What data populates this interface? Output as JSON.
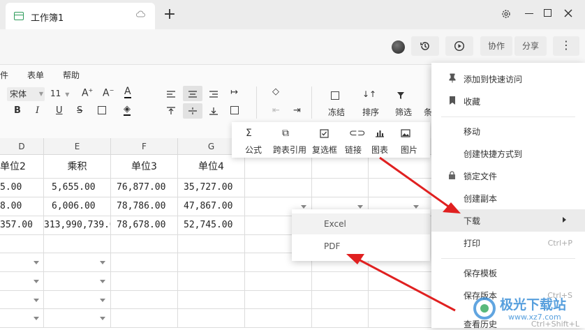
{
  "tab": {
    "title": "工作簿1"
  },
  "header": {
    "collab_label": "协作",
    "share_label": "分享"
  },
  "menubar": {
    "items": [
      "件",
      "表单",
      "帮助"
    ]
  },
  "toolbar": {
    "font_name": "宋体",
    "font_size": "11",
    "bold": "B",
    "italic": "I",
    "underline": "U",
    "strike": "S",
    "freeze_label": "冻结",
    "sort_label": "排序",
    "filter_label": "筛选",
    "cond_label": "条"
  },
  "insert_panel": {
    "items": [
      "公式",
      "跨表引用",
      "复选框",
      "链接",
      "图表",
      "图片"
    ]
  },
  "grid": {
    "columns": [
      "D",
      "E",
      "F",
      "G"
    ],
    "header_row": [
      "单位2",
      "乘积",
      "单位3",
      "单位4"
    ],
    "rows": [
      [
        "5.00",
        "5,655.00",
        "76,877.00",
        "35,727.00"
      ],
      [
        "8.00",
        "6,006.00",
        "78,786.00",
        "47,867.00"
      ],
      [
        "357.00",
        "313,990,739.0",
        "78,678.00",
        "52,745.00"
      ]
    ]
  },
  "submenu": {
    "items": [
      "Excel",
      "PDF"
    ]
  },
  "context_menu": {
    "items": [
      {
        "label": "添加到快速访问",
        "shortcut": ""
      },
      {
        "label": "收藏",
        "shortcut": ""
      },
      {
        "label": "移动",
        "shortcut": ""
      },
      {
        "label": "创建快捷方式到",
        "shortcut": ""
      },
      {
        "label": "锁定文件",
        "shortcut": ""
      },
      {
        "label": "创建副本",
        "shortcut": ""
      },
      {
        "label": "下载",
        "shortcut": ""
      },
      {
        "label": "打印",
        "shortcut": "Ctrl+P"
      },
      {
        "label": "保存模板",
        "shortcut": ""
      },
      {
        "label": "保存版本",
        "shortcut": "Ctrl+S"
      },
      {
        "label": "查看历史",
        "shortcut": "Ctrl+Shift+L"
      }
    ]
  },
  "watermark": {
    "site_name": "极光下载站",
    "url": "www.xz7.com"
  },
  "colors": {
    "accent_red": "#e02020",
    "green": "#2e9c5a",
    "menu_hover": "#ebebeb"
  }
}
